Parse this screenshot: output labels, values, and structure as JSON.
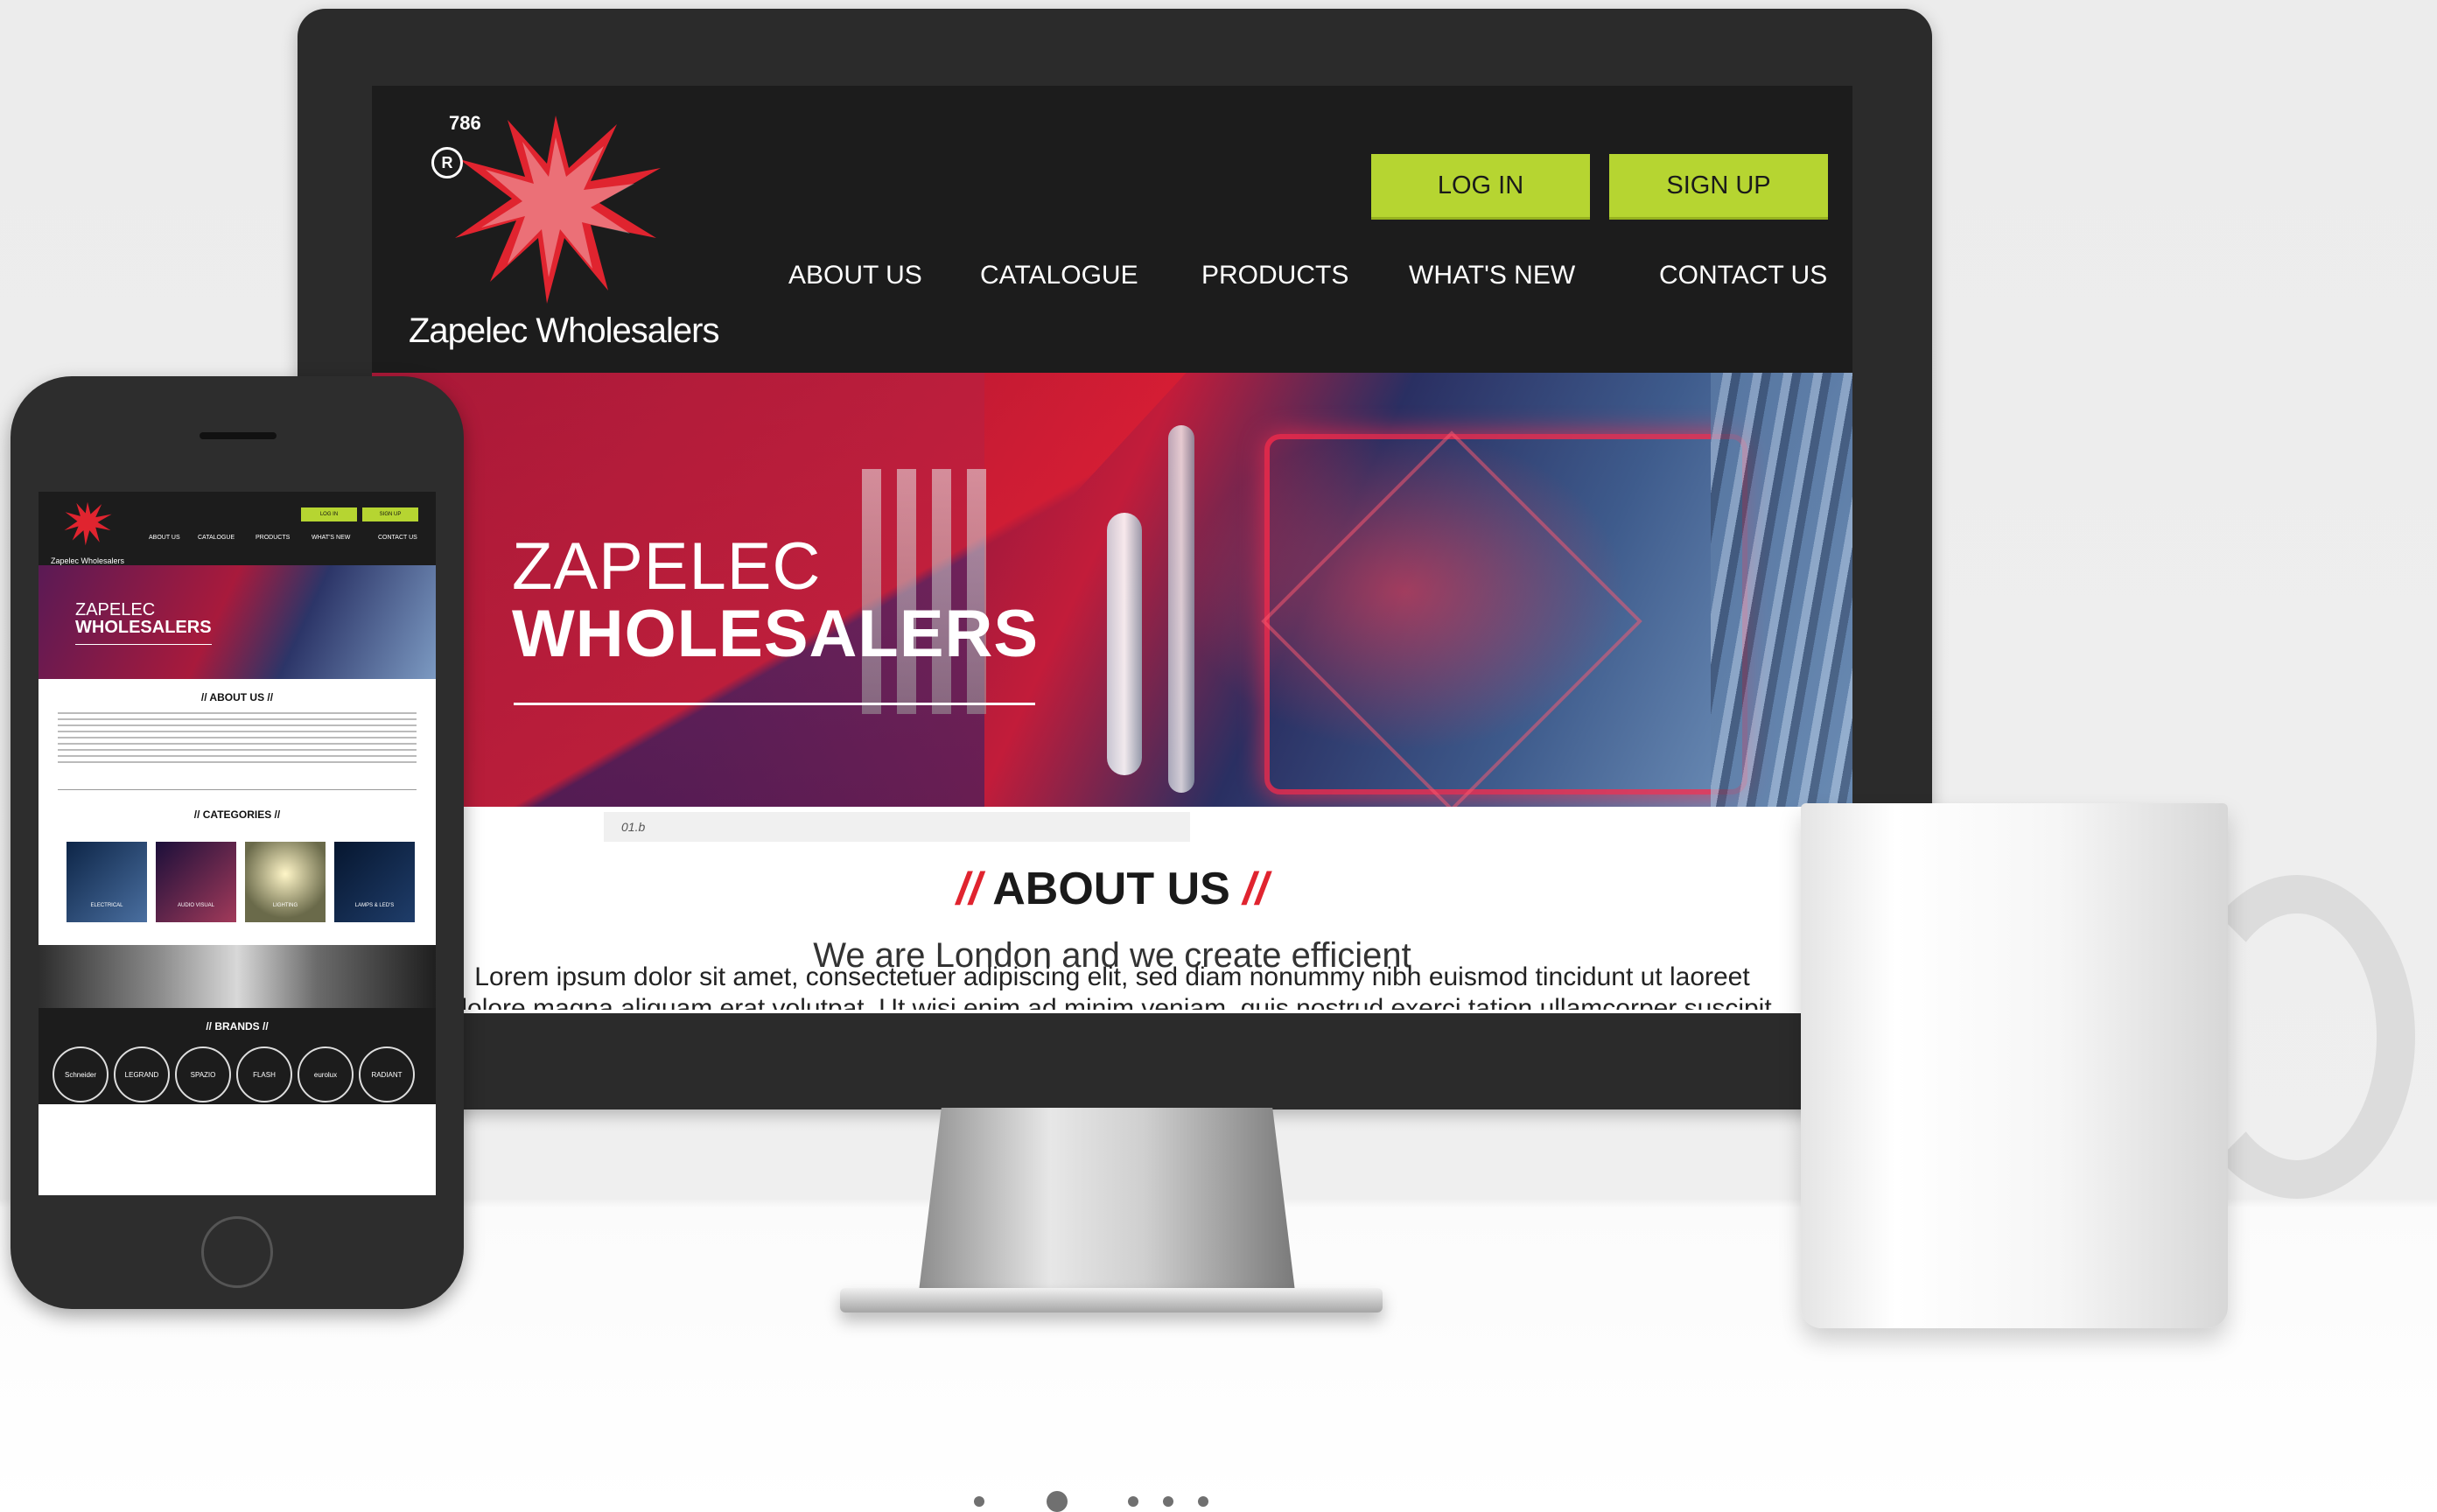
{
  "site": {
    "logo": {
      "number": "786",
      "registered": "R",
      "mark": "ZAP",
      "name": "Zapelec Wholesalers"
    },
    "header_buttons": {
      "login": "LOG IN",
      "signup": "SIGN UP"
    },
    "nav": [
      "ABOUT US",
      "CATALOGUE",
      "PRODUCTS",
      "WHAT'S NEW",
      "CONTACT US"
    ],
    "hero": {
      "line1": "ZAPELEC",
      "line2": "WHOLESALERS",
      "caption": "01.b"
    },
    "about": {
      "slash": "//",
      "title": "ABOUT US",
      "tagline": "We are London and we create efficient",
      "body": "Lorem ipsum dolor sit amet, consectetuer adipiscing elit, sed diam nonummy nibh euismod tincidunt ut laoreet",
      "body2": "dolore magna aliquam erat volutpat. Ut wisi enim ad minim veniam, quis nostrud exerci tation ullamcorper suscipit"
    }
  },
  "phone_site": {
    "logo_name": "Zapelec Wholesalers",
    "login": "LOG IN",
    "signup": "SIGN UP",
    "nav": [
      "ABOUT US",
      "CATALOGUE",
      "PRODUCTS",
      "WHAT'S NEW",
      "CONTACT US"
    ],
    "hero_line1": "ZAPELEC",
    "hero_line2": "WHOLESALERS",
    "about_title": "// ABOUT US //",
    "categories_title": "// CATEGORIES //",
    "categories": [
      "ELECTRICAL",
      "AUDIO VISUAL",
      "LIGHTING",
      "LAMPS & LED'S"
    ],
    "brands_title": "// BRANDS //",
    "brands": [
      "Schneider",
      "LEGRAND",
      "SPAZIO",
      "FLASH",
      "eurolux",
      "RADIANT"
    ]
  },
  "carousel": {
    "dot_count": 5,
    "active_index": 1
  },
  "colors": {
    "accent_green": "#b6d531",
    "accent_red": "#e0242f",
    "dark_bg": "#1c1c1c"
  }
}
